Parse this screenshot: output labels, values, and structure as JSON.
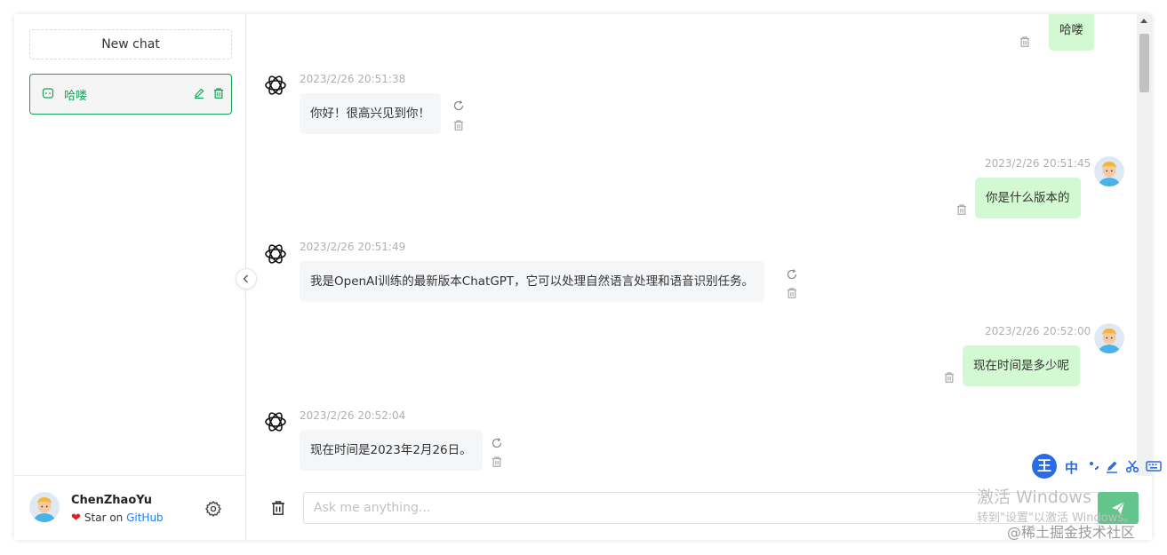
{
  "sidebar": {
    "new_chat_label": "New chat",
    "conversations": [
      {
        "title": "哈喽"
      }
    ],
    "user": {
      "name": "ChenZhaoYu",
      "star_text": "Star on ",
      "github_link": "GitHub"
    }
  },
  "messages": [
    {
      "role": "user",
      "time": "",
      "text": "哈喽"
    },
    {
      "role": "assistant",
      "time": "2023/2/26 20:51:38",
      "text": "你好！很高兴见到你！"
    },
    {
      "role": "user",
      "time": "2023/2/26 20:51:45",
      "text": "你是什么版本的"
    },
    {
      "role": "assistant",
      "time": "2023/2/26 20:51:49",
      "text": "我是OpenAI训练的最新版本ChatGPT，它可以处理自然语言处理和语音识别任务。"
    },
    {
      "role": "user",
      "time": "2023/2/26 20:52:00",
      "text": "现在时间是多少呢"
    },
    {
      "role": "assistant",
      "time": "2023/2/26 20:52:04",
      "text": "现在时间是2023年2月26日。"
    }
  ],
  "input": {
    "placeholder": "Ask me anything...",
    "value": ""
  },
  "overlay": {
    "ime_logo": "王",
    "ime_lang": "中",
    "activate_title": "激活 Windows",
    "activate_sub": "转到\"设置\"以激活 Windows。",
    "site_watermark": "@稀土掘金技术社区"
  },
  "colors": {
    "accent": "#18a058",
    "user_bubble": "#d2f9d1",
    "bot_bubble": "#f4f6f8",
    "send_button": "#63c48c",
    "link": "#2080f0"
  },
  "icons": {
    "chat": "message-icon",
    "edit": "edit-icon",
    "delete": "trash-icon",
    "regenerate": "refresh-icon",
    "settings": "gear-icon",
    "collapse": "chevron-left-icon",
    "send": "send-icon",
    "assistant_avatar": "openai-logo-icon"
  }
}
